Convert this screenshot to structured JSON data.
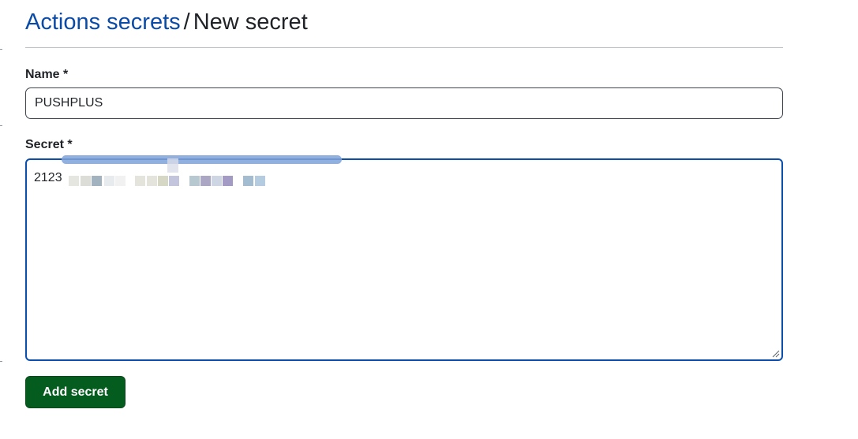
{
  "header": {
    "breadcrumb_link": "Actions secrets",
    "separator": "/",
    "current_page": "New secret"
  },
  "form": {
    "name_label": "Name *",
    "name_value": "PUSHPLUS",
    "secret_label": "Secret *",
    "secret_visible_value": "2123",
    "secret_redacted": true,
    "submit_label": "Add secret"
  },
  "colors": {
    "link": "#0a4ba8",
    "focus_border": "#0b4fae",
    "primary_button": "#055c1f",
    "redaction_stroke": "#7fa2d8"
  },
  "redaction_mosaic_colors": [
    "#e6e6e0",
    "#dcddd6",
    "#a2b3bf",
    "#e8ebee",
    "#f1f1f1",
    "#e4e3dc",
    "#e4e3dc",
    "#d6d8c5",
    "#c2c5db",
    "#b7c8d0",
    "#aaa6c4",
    "#cdd6e2",
    "#a39bc3",
    "#a4bcd0",
    "#b5cce0"
  ]
}
